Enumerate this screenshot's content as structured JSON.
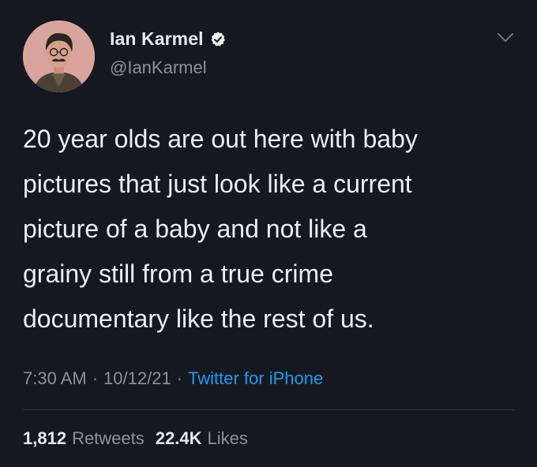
{
  "theme": {
    "background": "#15181f",
    "accent": "#1d9bf0",
    "secondary": "#8b9198"
  },
  "author": {
    "display_name": "Ian Karmel",
    "handle": "@IanKarmel",
    "verified_icon": "verified-badge-icon",
    "avatar_icon": "cartoon-portrait-avatar"
  },
  "menu_icon": "chevron-down-icon",
  "tweet": {
    "text": "20 year olds are out here with baby\npictures that just look like a current\npicture of a baby and not like a\ngrainy still from a true crime\ndocumentary like the rest of us."
  },
  "meta": {
    "time": "7:30 AM",
    "separator": "·",
    "date": "10/12/21",
    "source": "Twitter for iPhone"
  },
  "stats": {
    "retweets_count": "1,812",
    "retweets_label": "Retweets",
    "likes_count": "22.4K",
    "likes_label": "Likes"
  }
}
